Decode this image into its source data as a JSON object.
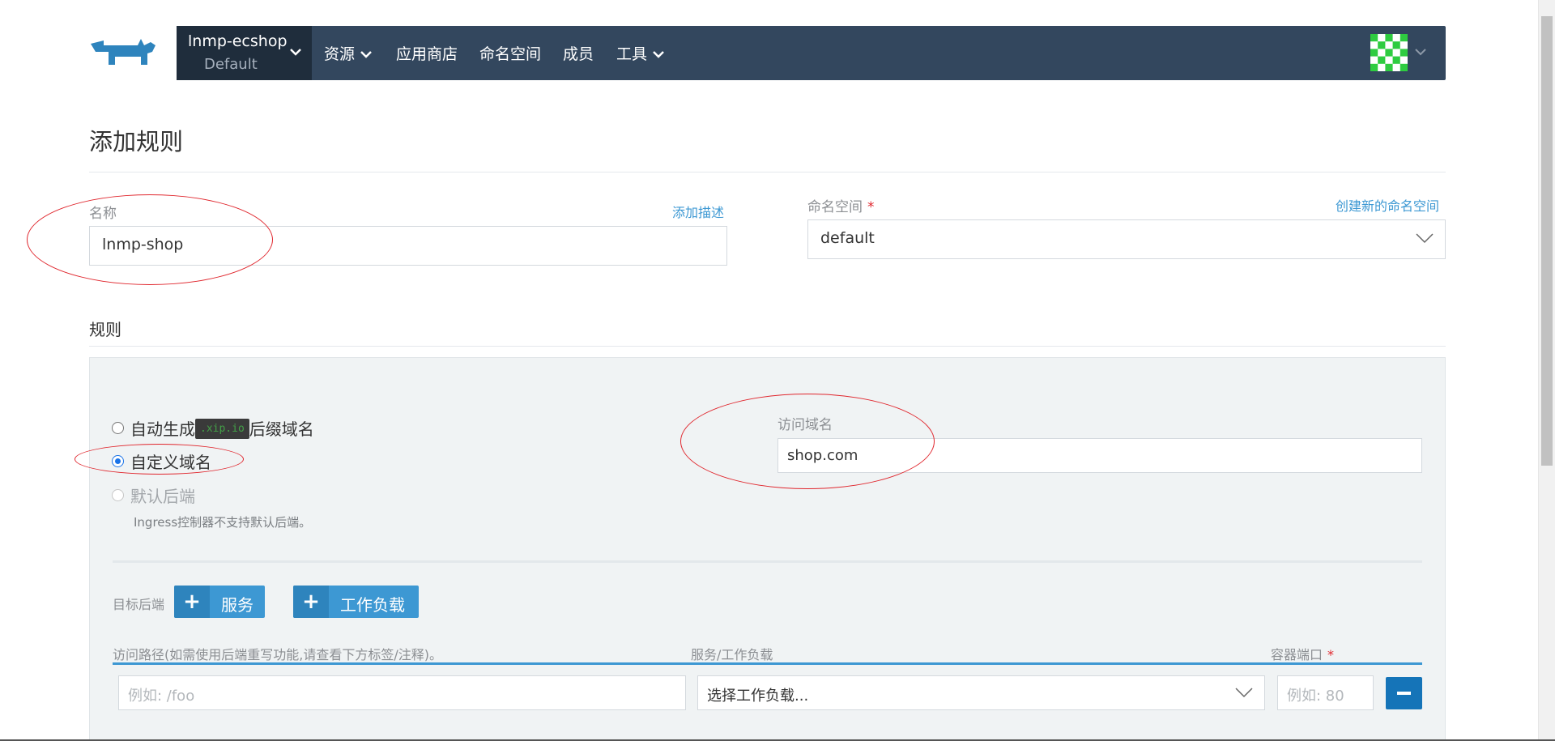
{
  "header": {
    "cluster_name": "lnmp-ecshop",
    "project_name": "Default",
    "nav": [
      "资源",
      "应用商店",
      "命名空间",
      "成员",
      "工具"
    ]
  },
  "page": {
    "title": "添加规则",
    "name_label": "名称",
    "add_description_link": "添加描述",
    "name_value": "lnmp-shop",
    "namespace_label": "命名空间",
    "required_mark": "*",
    "create_namespace_link": "创建新的命名空间",
    "namespace_value": "default",
    "rules_heading": "规则"
  },
  "rules": {
    "option_auto_prefix": "自动生成",
    "option_auto_chip": ".xip.io",
    "option_auto_suffix": "后缀域名",
    "option_custom": "自定义域名",
    "option_default_backend": "默认后端",
    "default_backend_help": "Ingress控制器不支持默认后端。",
    "domain_label": "访问域名",
    "domain_value": "shop.com",
    "target_backend_label": "目标后端",
    "add_service_button": "服务",
    "add_workload_button": "工作负载",
    "col_path": "访问路径(如需使用后端重写功能,请查看下方标签/注释)。",
    "col_service": "服务/工作负载",
    "col_port": "容器端口",
    "path_placeholder": "例如: /foo",
    "workload_placeholder": "选择工作负载...",
    "port_placeholder": "例如: 80"
  },
  "colors": {
    "nav_bg": "#33475e",
    "cluster_bg": "#1f2d3c",
    "accent": "#3d98d3",
    "annotation": "#e0262d"
  }
}
